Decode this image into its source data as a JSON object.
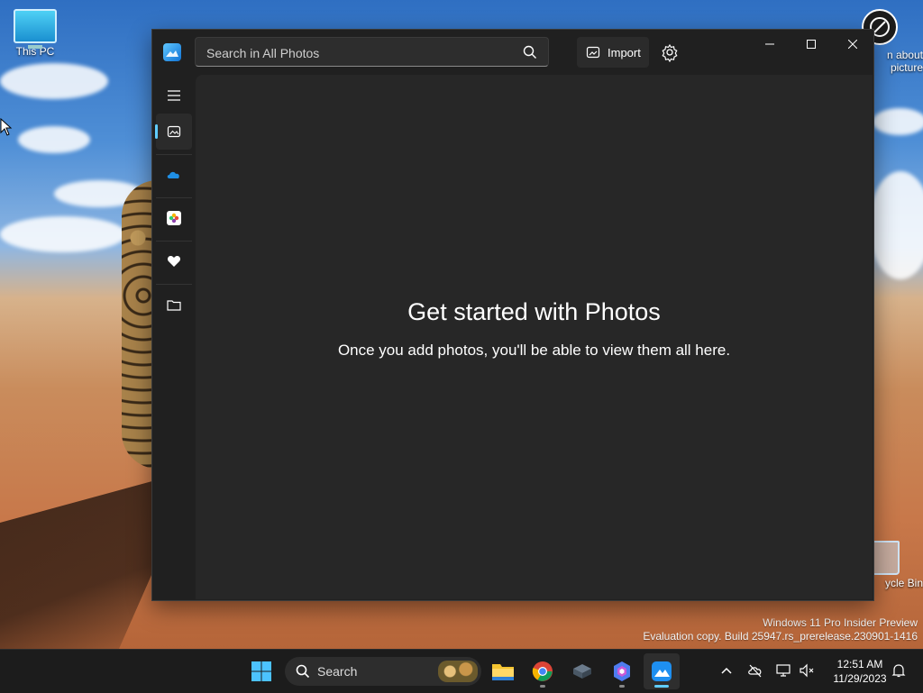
{
  "desktop": {
    "icons": [
      {
        "label": "This PC"
      },
      {
        "label": "Learn about this picture",
        "visible_text_1": "n about",
        "visible_text_2": "picture"
      },
      {
        "label": "Recycle Bin",
        "visible_text": "ycle Bin"
      }
    ],
    "watermark": {
      "line1": "Windows 11 Pro Insider Preview",
      "line2": "Evaluation copy. Build 25947.rs_prerelease.230901-1416"
    }
  },
  "photos_app": {
    "search": {
      "placeholder": "Search in All Photos",
      "value": ""
    },
    "toolbar": {
      "import_label": "Import"
    },
    "nav": [
      {
        "name": "Hamburger menu"
      },
      {
        "name": "All Photos",
        "active": true
      },
      {
        "name": "OneDrive"
      },
      {
        "name": "iCloud Photos"
      },
      {
        "name": "Favorites"
      },
      {
        "name": "Folders"
      }
    ],
    "empty_state": {
      "title": "Get started with Photos",
      "subtitle": "Once you add photos, you'll be able to view them all here."
    }
  },
  "taskbar": {
    "search_label": "Search",
    "clock": {
      "time": "12:51 AM",
      "date": "11/29/2023"
    },
    "apps": [
      "Start",
      "Search",
      "File Explorer",
      "Google Chrome",
      "Virtual Box",
      "Copilot",
      "Photos"
    ],
    "colors": {
      "accent": "#60cdff"
    }
  }
}
